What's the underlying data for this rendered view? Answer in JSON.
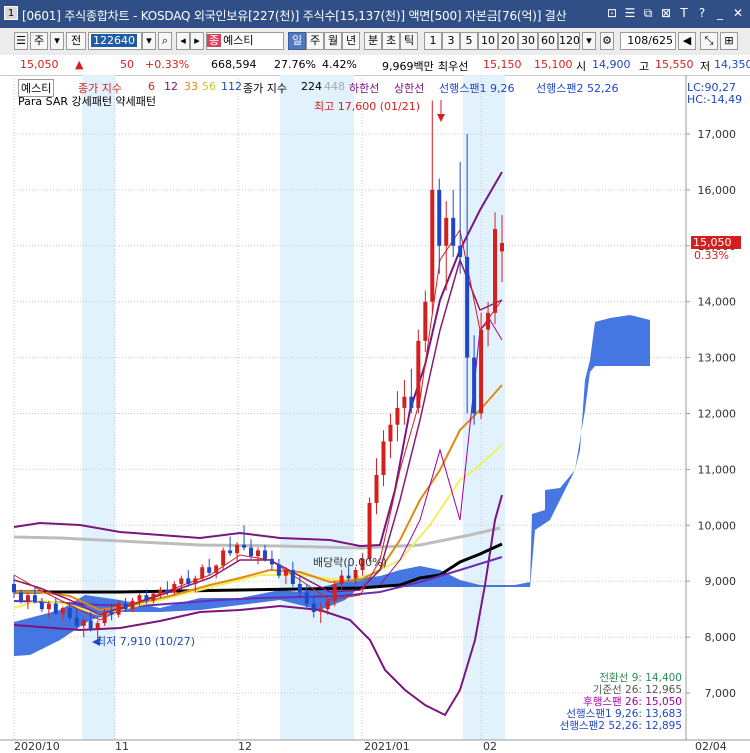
{
  "window": {
    "number": "1",
    "title": "[0601] 주식종합차트 - KOSDAQ 외국인보유[227(천)] 주식수[15,137(천)] 액면[500] 자본금[76(억)] 결산"
  },
  "window_buttons": [
    "⊡",
    "☰",
    "⧉",
    "⊠",
    "T",
    "?",
    "_",
    "✕"
  ],
  "toolbar": {
    "market": "주",
    "jeon": "전",
    "code": "122640",
    "name_tag": "종",
    "name": "예스티",
    "periods": [
      "일",
      "주",
      "월",
      "년"
    ],
    "minute_tick": [
      "분",
      "초",
      "틱"
    ],
    "intervals": [
      "1",
      "3",
      "5",
      "10",
      "20",
      "30",
      "60",
      "120"
    ],
    "page_counter": "108/625"
  },
  "infobar": {
    "price": "15,050",
    "change_arrow": "▲",
    "change": "50",
    "change_pct": "+0.33%",
    "volume": "668,594",
    "turnover_pct": "27.76%",
    "vol_ratio": "4.42%",
    "amount": "9,969백만",
    "best_ask_label": "최우선",
    "best_ask": "15,150",
    "best_bid": "15,100",
    "open_label": "시",
    "open": "14,900",
    "high_label": "고",
    "high": "15,550",
    "low_label": "저",
    "low": "14,350"
  },
  "legend": {
    "stock_name": "예스티",
    "ma_title": "종가 지수",
    "ma": [
      "6",
      "12",
      "33",
      "56",
      "112"
    ],
    "ma2_title": "종가 지수",
    "ma2": "224",
    "ma3": "448",
    "lower_line": "하한선",
    "upper_line": "상한선",
    "span1": "선행스팬1 9,26",
    "span2": "선행스팬2 52,26",
    "psar_line": "Para SAR 강세패턴   약세패턴",
    "lc": "LC:90,27",
    "hc": "HC:-14,49"
  },
  "annotations": {
    "high": "최고 17,600 (01/21)",
    "low": "최저 7,910 (10/27)",
    "dividend": "배당락(0.00%)"
  },
  "ichimoku_box": [
    {
      "label": "전환선 9: 14,400",
      "color": "#2e8b57"
    },
    {
      "label": "기준선 26: 12,965",
      "color": "#555555"
    },
    {
      "label": "후행스팬 26: 15,050",
      "color": "#a000a0"
    },
    {
      "label": "선행스팬1 9,26: 13,683",
      "color": "#1f46c8"
    },
    {
      "label": "선행스팬2 52,26: 12,895",
      "color": "#1f46c8"
    }
  ],
  "chart_data": {
    "type": "candlestick",
    "yaxis_labels": [
      "17,000",
      "16,000",
      "15,000",
      "14,000",
      "13,000",
      "12,000",
      "11,000",
      "10,000",
      "9,000",
      "8,000",
      "7,000"
    ],
    "yaxis_values": [
      17000,
      16000,
      15000,
      14000,
      13000,
      12000,
      11000,
      10000,
      9000,
      8000,
      7000
    ],
    "ylim": [
      6500,
      17700
    ],
    "xaxis_labels": [
      "2020/10",
      "11",
      "12",
      "2021/01",
      "02",
      "02/04"
    ],
    "current_price_label": "15,050",
    "current_change_label": "0.33%",
    "high": 17600,
    "low": 7910
  },
  "colors": {
    "up": "#d41f1f",
    "down": "#1f46c8",
    "cloud": "#3b6fe0",
    "band": "#e2f2fc",
    "envelope": "#7a1580",
    "ma448": "#bdbdbd",
    "ma224": "#000000"
  }
}
